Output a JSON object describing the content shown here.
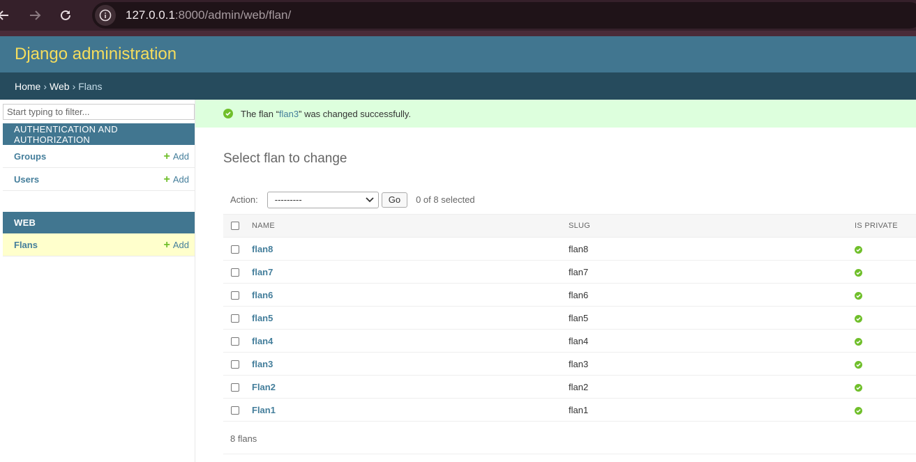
{
  "browser": {
    "url_host": "127.0.0.1",
    "url_rest": ":8000/admin/web/flan/"
  },
  "header": {
    "branding": "Django administration"
  },
  "breadcrumbs": {
    "home": "Home",
    "sep1": "›",
    "app": "Web",
    "sep2": "›",
    "current": "Flans"
  },
  "sidebar": {
    "filter_placeholder": "Start typing to filter...",
    "modules": [
      {
        "caption": "AUTHENTICATION AND AUTHORIZATION",
        "models": [
          {
            "name": "Groups",
            "add": "Add"
          },
          {
            "name": "Users",
            "add": "Add"
          }
        ]
      },
      {
        "caption": "WEB",
        "models": [
          {
            "name": "Flans",
            "add": "Add"
          }
        ]
      }
    ]
  },
  "message": {
    "prefix": "The flan “",
    "link": "flan3",
    "suffix": "” was changed successfully."
  },
  "main": {
    "title": "Select flan to change",
    "action_label": "Action:",
    "action_value": "---------",
    "go_label": "Go",
    "selected_count": "0 of 8 selected",
    "columns": {
      "name": "NAME",
      "slug": "SLUG",
      "is_private": "IS PRIVATE"
    },
    "rows": [
      {
        "name": "flan8",
        "slug": "flan8",
        "is_private": true
      },
      {
        "name": "flan7",
        "slug": "flan7",
        "is_private": true
      },
      {
        "name": "flan6",
        "slug": "flan6",
        "is_private": true
      },
      {
        "name": "flan5",
        "slug": "flan5",
        "is_private": true
      },
      {
        "name": "flan4",
        "slug": "flan4",
        "is_private": true
      },
      {
        "name": "flan3",
        "slug": "flan3",
        "is_private": true
      },
      {
        "name": "Flan2",
        "slug": "flan2",
        "is_private": true
      },
      {
        "name": "Flan1",
        "slug": "flan1",
        "is_private": true
      }
    ],
    "paginator": "8 flans"
  },
  "colors": {
    "header": "#417690",
    "breadcrumbs": "#264b5d",
    "branding": "#f5dd5d",
    "link": "#447e9b",
    "success": "#70bf2b",
    "current_row": "#ffffcc"
  }
}
